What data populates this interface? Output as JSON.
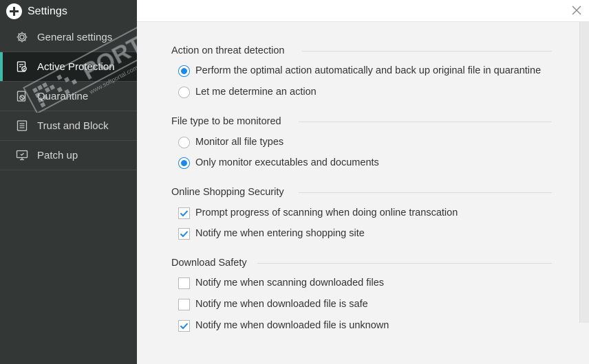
{
  "sidebar": {
    "title": "Settings",
    "items": [
      {
        "label": "General settings",
        "icon": "gear-icon"
      },
      {
        "label": "Active Protection",
        "icon": "shield-icon"
      },
      {
        "label": "Quarantine",
        "icon": "quarantine-icon"
      },
      {
        "label": "Trust and Block",
        "icon": "list-icon"
      },
      {
        "label": "Patch up",
        "icon": "monitor-icon"
      }
    ],
    "active_item": "Active Protection"
  },
  "watermark": {
    "text": "PORTAL",
    "sub": "www.softportal.com",
    "tm": "TM"
  },
  "sections": [
    {
      "title": "Action on threat detection",
      "type": "radio",
      "options": [
        {
          "label": "Perform the optimal action automatically and back up original file in quarantine",
          "checked": true
        },
        {
          "label": "Let me determine an action",
          "checked": false
        }
      ]
    },
    {
      "title": "File type to be monitored",
      "type": "radio",
      "options": [
        {
          "label": "Monitor all file types",
          "checked": false
        },
        {
          "label": "Only monitor executables and documents",
          "checked": true
        }
      ]
    },
    {
      "title": "Online Shopping Security",
      "type": "checkbox",
      "options": [
        {
          "label": "Prompt progress of scanning when doing online transcation",
          "checked": true
        },
        {
          "label": "Notify me when entering shopping site",
          "checked": true
        }
      ]
    },
    {
      "title": "Download Safety",
      "type": "checkbox",
      "options": [
        {
          "label": "Notify me when scanning downloaded files",
          "checked": false
        },
        {
          "label": "Notify me when downloaded file is safe",
          "checked": false
        },
        {
          "label": "Notify me when downloaded file is unknown",
          "checked": true
        }
      ]
    }
  ],
  "colors": {
    "accent": "#1e88e5",
    "sidebar_bg": "#333837",
    "active_bar": "#3fb8a8"
  }
}
